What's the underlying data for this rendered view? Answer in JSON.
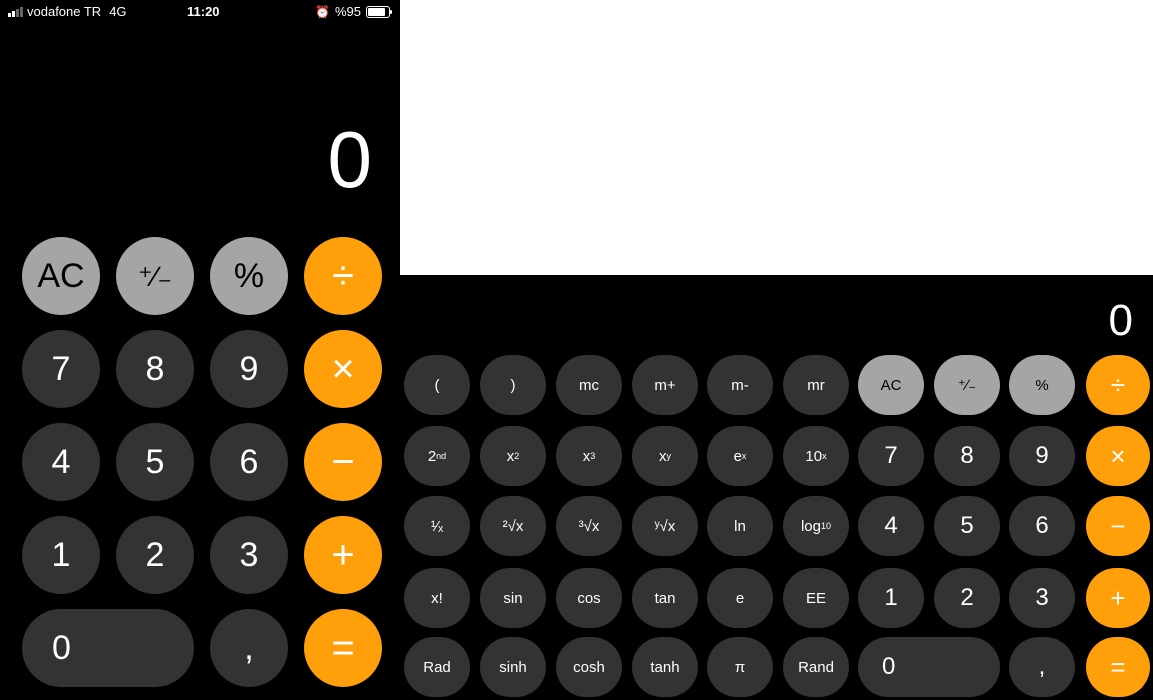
{
  "status_bar": {
    "carrier": "vodafone TR",
    "network": "4G",
    "time": "11:20",
    "battery": "%95",
    "battery_level": 0.95
  },
  "portrait": {
    "display": "0",
    "rows": [
      [
        "AC",
        "⁺∕₋",
        "%",
        "÷"
      ],
      [
        "7",
        "8",
        "9",
        "×"
      ],
      [
        "4",
        "5",
        "6",
        "−"
      ],
      [
        "1",
        "2",
        "3",
        "+"
      ],
      [
        "0",
        ",",
        "="
      ]
    ]
  },
  "landscape": {
    "display": "0",
    "sci": {
      "open_paren": "(",
      "close_paren": ")",
      "mc": "mc",
      "mplus": "m+",
      "mminus": "m-",
      "mr": "mr",
      "second": "2",
      "second_sup": "nd",
      "x": "x",
      "x2_sup": "2",
      "x3_sup": "3",
      "xy_sup": "y",
      "e": "e",
      "ex_sup": "x",
      "ten": "10",
      "tenx_sup": "x",
      "reciprocal": "¹⁄ₓ",
      "sqrt2": "²√x",
      "sqrt3": "³√x",
      "sqrty": "ʸ√x",
      "ln": "ln",
      "log": "log",
      "log_sub": "10",
      "fact": "x!",
      "sin": "sin",
      "cos": "cos",
      "tan": "tan",
      "e_const": "e",
      "ee": "EE",
      "rad": "Rad",
      "sinh": "sinh",
      "cosh": "cosh",
      "tanh": "tanh",
      "pi": "π",
      "rand": "Rand"
    },
    "keys": {
      "ac": "AC",
      "sign": "⁺∕₋",
      "percent": "%",
      "divide": "÷",
      "seven": "7",
      "eight": "8",
      "nine": "9",
      "multiply": "×",
      "four": "4",
      "five": "5",
      "six": "6",
      "minus": "−",
      "one": "1",
      "two": "2",
      "three": "3",
      "plus": "+",
      "zero": "0",
      "comma": ",",
      "equals": "="
    }
  },
  "colors": {
    "background": "#000000",
    "dark_key": "#333333",
    "light_key": "#a5a5a5",
    "operator_key": "#ff9f0a"
  }
}
